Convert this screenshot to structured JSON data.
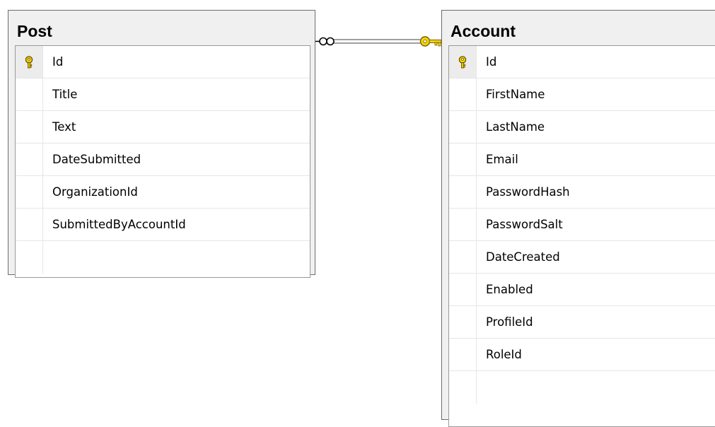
{
  "tables": [
    {
      "name": "Post",
      "columns": [
        {
          "name": "Id",
          "primary_key": true
        },
        {
          "name": "Title",
          "primary_key": false
        },
        {
          "name": "Text",
          "primary_key": false
        },
        {
          "name": "DateSubmitted",
          "primary_key": false
        },
        {
          "name": "OrganizationId",
          "primary_key": false
        },
        {
          "name": "SubmittedByAccountId",
          "primary_key": false
        }
      ]
    },
    {
      "name": "Account",
      "columns": [
        {
          "name": "Id",
          "primary_key": true
        },
        {
          "name": "FirstName",
          "primary_key": false
        },
        {
          "name": "LastName",
          "primary_key": false
        },
        {
          "name": "Email",
          "primary_key": false
        },
        {
          "name": "PasswordHash",
          "primary_key": false
        },
        {
          "name": "PasswordSalt",
          "primary_key": false
        },
        {
          "name": "DateCreated",
          "primary_key": false
        },
        {
          "name": "Enabled",
          "primary_key": false
        },
        {
          "name": "ProfileId",
          "primary_key": false
        },
        {
          "name": "RoleId",
          "primary_key": false
        }
      ]
    }
  ],
  "relationship": {
    "from_table": "Post",
    "to_table": "Account",
    "from_end": "many-infinity-icon",
    "to_end": "one-key-icon"
  },
  "colors": {
    "key_icon": "#f5d800",
    "key_outline": "#8a6d00",
    "connector": "#808080"
  }
}
